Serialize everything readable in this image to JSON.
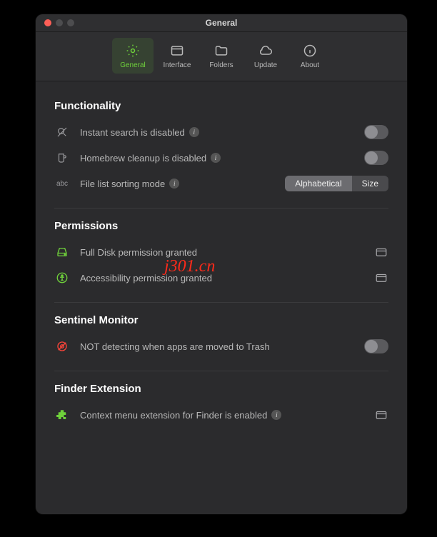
{
  "window_title": "General",
  "tabs": {
    "general": "General",
    "interface": "Interface",
    "folders": "Folders",
    "update": "Update",
    "about": "About"
  },
  "sections": {
    "functionality": {
      "title": "Functionality",
      "instant_search": "Instant search is disabled",
      "homebrew_cleanup": "Homebrew cleanup is disabled",
      "sort_mode_label": "File list sorting mode",
      "sort_lead_icon_text": "abc",
      "sort_options": {
        "alphabetical": "Alphabetical",
        "size": "Size"
      }
    },
    "permissions": {
      "title": "Permissions",
      "full_disk": "Full Disk permission granted",
      "accessibility": "Accessibility permission granted"
    },
    "sentinel": {
      "title": "Sentinel Monitor",
      "detecting": "NOT detecting when apps are moved to Trash"
    },
    "finder_ext": {
      "title": "Finder Extension",
      "context_menu": "Context menu extension for Finder is enabled"
    }
  },
  "watermark": "j301.cn"
}
